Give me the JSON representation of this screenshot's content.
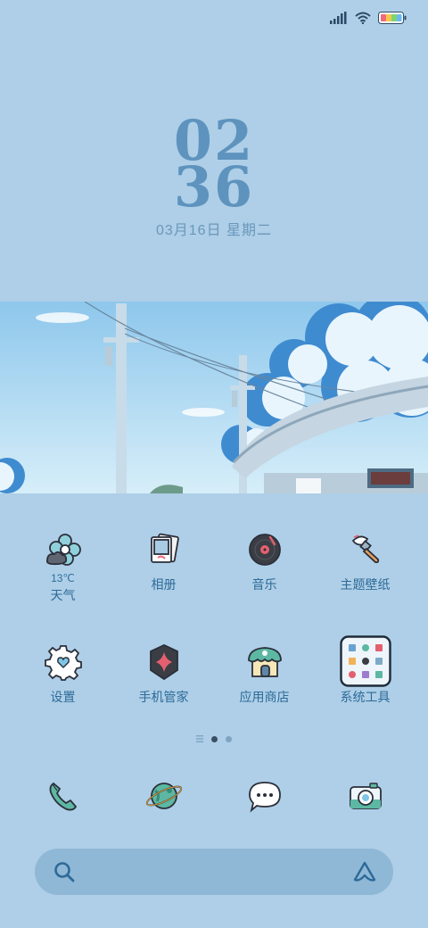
{
  "status_bar": {
    "icons": [
      "signal-icon",
      "wifi-icon",
      "battery-icon"
    ],
    "battery_colors": [
      "#f06b7a",
      "#f5c84b",
      "#7bd66f",
      "#6ab8f5"
    ]
  },
  "clock": {
    "hours": "02",
    "minutes": "36",
    "date": "03月16日 星期二"
  },
  "apps": [
    {
      "label": "天气",
      "sub": "13℃",
      "icon": "weather-icon"
    },
    {
      "label": "相册",
      "icon": "gallery-icon"
    },
    {
      "label": "音乐",
      "icon": "music-icon"
    },
    {
      "label": "主题壁纸",
      "icon": "themes-icon"
    },
    {
      "label": "设置",
      "icon": "settings-icon"
    },
    {
      "label": "手机管家",
      "icon": "security-icon"
    },
    {
      "label": "应用商店",
      "icon": "app-store-icon"
    },
    {
      "label": "系统工具",
      "icon": "system-tools-folder-icon"
    }
  ],
  "page_indicator": {
    "pages": 2,
    "current": 1
  },
  "dock": [
    {
      "icon": "phone-icon"
    },
    {
      "icon": "browser-planet-icon"
    },
    {
      "icon": "messages-icon"
    },
    {
      "icon": "camera-icon"
    }
  ],
  "search_bar": {
    "left_icon": "search-icon",
    "right_icon": "assistant-icon"
  },
  "colors": {
    "background": "#aecfe7",
    "accent": "#2d6a98",
    "search_bar": "#8fb8d6"
  }
}
